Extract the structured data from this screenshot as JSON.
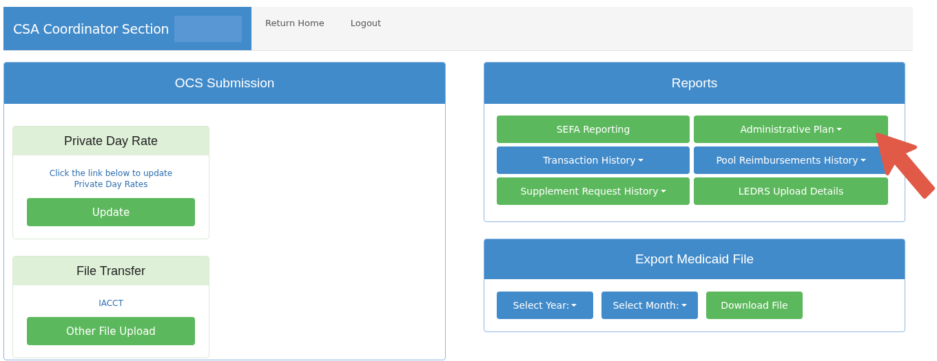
{
  "header": {
    "brand": "CSA Coordinator Section",
    "nav": [
      "Return Home",
      "Logout"
    ]
  },
  "ocs_submission": {
    "title": "OCS Submission",
    "cards": [
      {
        "title": "Private Day Rate",
        "text": "Click the link below to update Private Day Rates",
        "button": "Update"
      },
      {
        "title": "File Transfer",
        "text": "IACCT",
        "button": "Other File Upload"
      }
    ]
  },
  "reports": {
    "title": "Reports",
    "buttons": [
      {
        "label": "SEFA Reporting",
        "color": "#5cb85c",
        "dropdown": false
      },
      {
        "label": "Administrative Plan",
        "color": "#5cb85c",
        "dropdown": true
      },
      {
        "label": "Transaction History ",
        "color": "#428bca",
        "dropdown": true
      },
      {
        "label": "Pool Reimbursements History ",
        "color": "#428bca",
        "dropdown": true
      },
      {
        "label": "Supplement Request History",
        "color": "#5cb85c",
        "dropdown": true
      },
      {
        "label": "LEDRS Upload Details",
        "color": "#5cb85c",
        "dropdown": false
      }
    ]
  },
  "export_medicaid": {
    "title": "Export Medicaid File",
    "buttons": [
      {
        "label": "Select Year: ",
        "color": "#428bca",
        "dropdown": true
      },
      {
        "label": "Select Month: ",
        "color": "#428bca",
        "dropdown": true
      },
      {
        "label": "Download File",
        "color": "#5cb85c",
        "dropdown": false
      }
    ]
  }
}
